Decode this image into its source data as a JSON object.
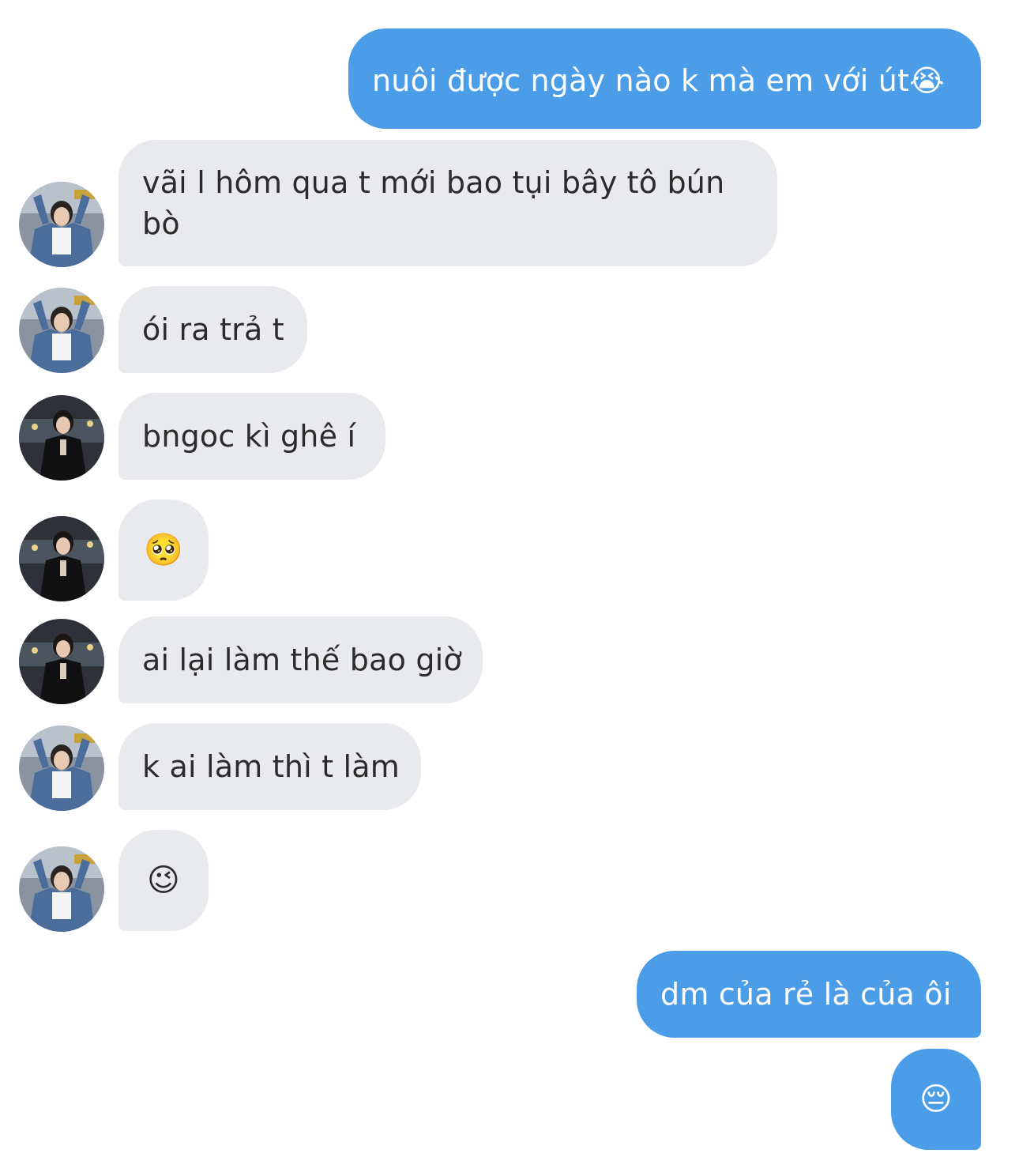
{
  "conversation": {
    "messages": [
      {
        "id": "m1",
        "side": "outgoing",
        "text": "nuôi được ngày nào k mà em với út😭"
      },
      {
        "id": "m2",
        "side": "incoming",
        "sender_avatar": "avatar-denim",
        "text": "vãi l hôm qua t mới bao tụi bây tô bún bò"
      },
      {
        "id": "m3",
        "side": "incoming",
        "sender_avatar": "avatar-denim",
        "text": "ói ra trả t"
      },
      {
        "id": "m4",
        "side": "incoming",
        "sender_avatar": "avatar-black-dress",
        "text": "bngoc kì ghê í"
      },
      {
        "id": "m5",
        "side": "incoming",
        "sender_avatar": "avatar-black-dress",
        "text": "🥺"
      },
      {
        "id": "m6",
        "side": "incoming",
        "sender_avatar": "avatar-black-dress",
        "text": "ai lại làm thế bao giờ"
      },
      {
        "id": "m7",
        "side": "incoming",
        "sender_avatar": "avatar-denim",
        "text": "k ai làm thì t làm"
      },
      {
        "id": "m8",
        "side": "incoming",
        "sender_avatar": "avatar-denim",
        "text": "😉"
      },
      {
        "id": "m9",
        "side": "outgoing",
        "text": "dm của rẻ là của ôi"
      },
      {
        "id": "m10",
        "side": "outgoing",
        "text": "😔"
      }
    ]
  },
  "colors": {
    "outgoing_bubble": "#4c9de8",
    "incoming_bubble": "#e8eaee",
    "outgoing_text": "#ffffff",
    "incoming_text": "#2b2b2b"
  }
}
